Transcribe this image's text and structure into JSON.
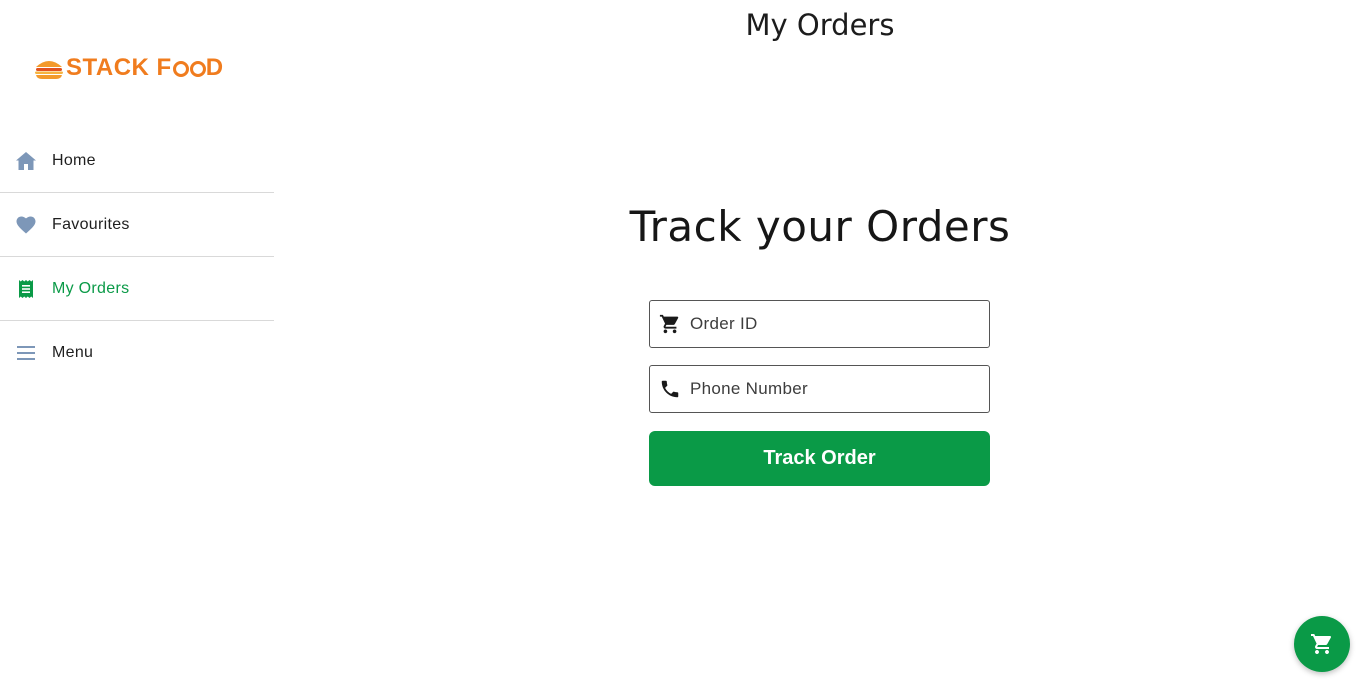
{
  "brand": {
    "logo_text_before": "STACK F",
    "logo_text_after": "D",
    "logo_full": "STACK FOOD",
    "logo_icon": "burger-logo-icon",
    "accent_color": "#0a9a47",
    "brand_color": "#f07c1e"
  },
  "header": {
    "title": "My Orders"
  },
  "sidebar": {
    "items": [
      {
        "label": "Home",
        "icon": "home-icon",
        "active": false
      },
      {
        "label": "Favourites",
        "icon": "heart-icon",
        "active": false
      },
      {
        "label": "My Orders",
        "icon": "receipt-icon",
        "active": true
      },
      {
        "label": "Menu",
        "icon": "menu-icon",
        "active": false
      }
    ]
  },
  "main": {
    "heading": "Track your Orders",
    "order_id": {
      "placeholder": "Order ID",
      "value": "",
      "icon": "cart-icon"
    },
    "phone": {
      "placeholder": "Phone Number",
      "value": "",
      "icon": "phone-icon"
    },
    "track_button_label": "Track Order"
  },
  "fab": {
    "icon": "cart-icon"
  }
}
